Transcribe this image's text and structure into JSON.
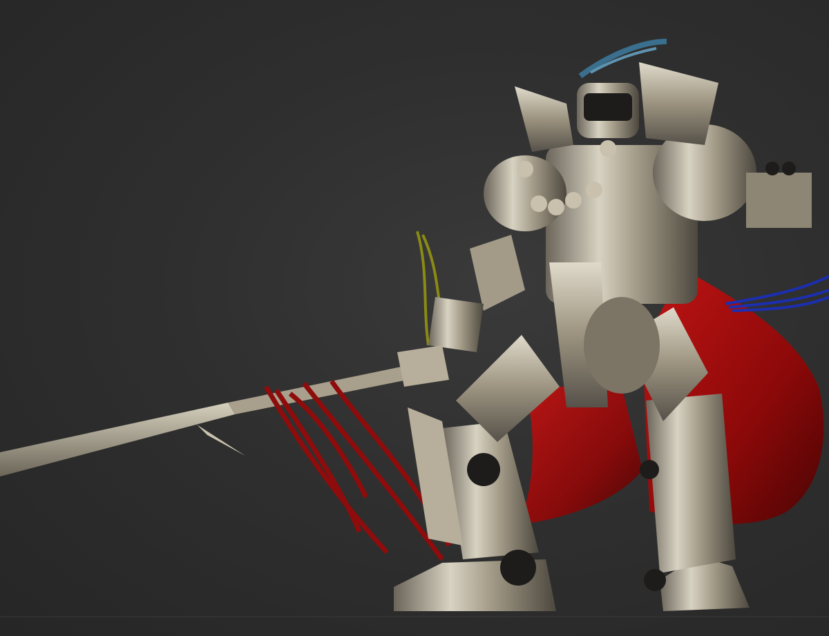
{
  "scene": {
    "subject": "armored-robot-samurai-render",
    "colors": {
      "background": "#2d2d2d",
      "armor_light": "#d8d2c2",
      "armor_mid": "#9e9684",
      "armor_dark": "#4a463e",
      "cape": "#a80d0d",
      "cape_dark": "#5a0606",
      "ribbon_red": "#8e0c0c",
      "ribbon_blue": "#1b2fb0",
      "ribbon_yellow": "#8a8a14",
      "helmet_crest": "#3b6f8e",
      "spear": "#b7b09c"
    }
  }
}
